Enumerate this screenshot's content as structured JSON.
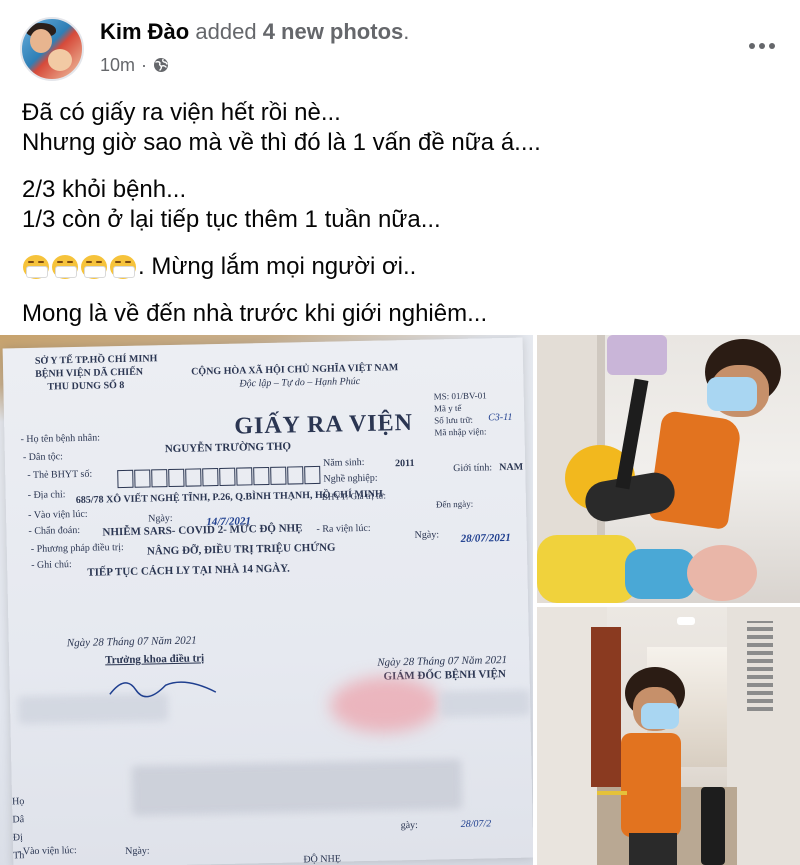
{
  "post": {
    "author": "Kim Đào",
    "action_prefix": "added",
    "action_bold": "4 new photos",
    "action_suffix": ".",
    "time": "10m",
    "separator": "·",
    "privacy_icon": "globe-icon",
    "more_icon": "more-options-icon"
  },
  "content": {
    "line1": "Đã có giấy ra viện hết rồi nè...",
    "line2": "Nhưng giờ sao mà về thì đó là 1 vấn đề nữa á....",
    "line3": "2/3 khỏi bệnh...",
    "line4": "1/3 còn ở lại tiếp tục thêm 1 tuần nữa...",
    "emoji_icon": "face-with-medical-mask-emoji",
    "emoji_count": 4,
    "line5_text": ". Mừng lắm mọi người ơi..",
    "line6": "Mong là về đến nhà trước khi giới nghiêm..."
  },
  "photos": {
    "document": {
      "header_left_1": "SỞ Y TẾ TP.HỒ CHÍ MINH",
      "header_left_2": "BỆNH VIỆN DÃ CHIẾN",
      "header_left_3": "THU DUNG SỐ 8",
      "header_center_1": "CỘNG HÒA XÃ HỘI CHỦ NGHĨA VIỆT NAM",
      "header_center_2": "Độc lập – Tự do – Hạnh Phúc",
      "header_right_1": "MS: 01/BV-01",
      "header_right_2": "Mã y tế",
      "header_right_3": "Số lưu trữ:",
      "header_right_3_val": "C3-11",
      "header_right_4": "Mã nhập viện:",
      "title": "GIẤY RA VIỆN",
      "label_name": "- Họ tên bệnh nhân:",
      "value_name": "NGUYỄN TRƯỜNG THỌ",
      "label_birth": "Năm sinh:",
      "value_birth": "2011",
      "label_ethnic": "- Dân tộc:",
      "label_job": "Nghề nghiệp:",
      "label_gender": "Giới tính:",
      "value_gender": "NAM",
      "label_bhyt": "- Thẻ BHYT số:",
      "label_bhyt_valid": "BHYT: Giá trị từ:",
      "label_bhyt_to": "Đến ngày:",
      "label_address": "- Địa chỉ:",
      "value_address": "685/78 XÔ VIẾT NGHỆ TĨNH, P.26, Q.BÌNH THẠNH, HỒ CHÍ MINH",
      "label_admit": "- Vào viện lúc:",
      "label_admit_day": "Ngày:",
      "value_admit_day": "14/7/2021",
      "label_discharge": "- Ra viện lúc:",
      "label_discharge_day": "Ngày:",
      "value_discharge_day": "28/07/2021",
      "label_diagnosis": "- Chẩn đoán:",
      "value_diagnosis": "NHIỄM SARS- COVID 2- MỨC ĐỘ NHẸ",
      "label_treatment": "- Phương pháp điều trị:",
      "value_treatment": "NÂNG ĐỠ, ĐIỀU TRỊ TRIỆU CHỨNG",
      "label_note": "- Ghi chú:",
      "value_note": "TIẾP TỤC CÁCH LY TẠI NHÀ 14 NGÀY.",
      "left_date": "Ngày 28 Tháng 07 Năm 2021",
      "left_role": "Trưởng khoa điều trị",
      "right_date": "Ngày 28 Tháng 07 Năm 2021",
      "right_role": "GIÁM ĐỐC BỆNH VIỆN",
      "bottom_left_1": "Họ",
      "bottom_left_2": "Dâ",
      "bottom_left_3": "Đị",
      "bottom_left_4": "Th",
      "bottom_left_5": "Ch",
      "bottom_label_admit": "- Vào viện lúc:",
      "bottom_label_day": "Ngày:",
      "bottom_right_day": "gày:",
      "bottom_right_date": "28/07/2",
      "bottom_right_partial": "ĐỘ NHẸ"
    },
    "photo2_alt": "child-sitting-in-hallway-photo",
    "photo3_alt": "child-in-corridor-with-suitcase-photo"
  },
  "colors": {
    "text_primary": "#050505",
    "text_secondary": "#65676b",
    "ink_blue": "#1f3f8f",
    "orange_shirt": "#e2731f",
    "mask_blue": "#a9d6f2"
  }
}
